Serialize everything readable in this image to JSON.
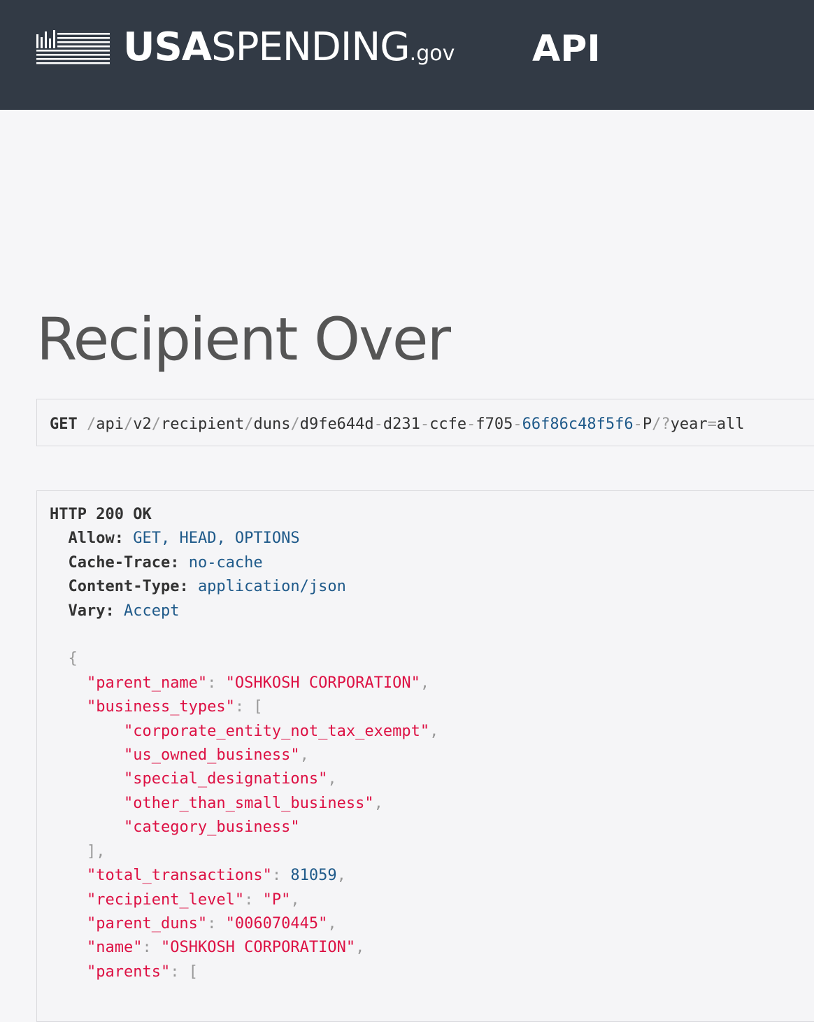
{
  "brand": {
    "usa": "USA",
    "spending": "SPENDING",
    "gov": ".gov",
    "api": "API",
    "logo_icon": "bar-lines-icon"
  },
  "page": {
    "title": "Recipient Over"
  },
  "request": {
    "method": "GET",
    "path_parts": [
      "/",
      "api",
      "/",
      "v2",
      "/",
      "recipient",
      "/",
      "duns",
      "/",
      "d9fe644d",
      "-",
      "d231",
      "-",
      "ccfe",
      "-",
      "f705",
      "-",
      "66f86c48f5f6",
      "-",
      "P",
      "/?",
      "year",
      "=",
      "all"
    ]
  },
  "response": {
    "status": "HTTP 200 OK",
    "headers": [
      {
        "name": "Allow:",
        "value": "GET, HEAD, OPTIONS"
      },
      {
        "name": "Cache-Trace:",
        "value": "no-cache"
      },
      {
        "name": "Content-Type:",
        "value": "application/json"
      },
      {
        "name": "Vary:",
        "value": "Accept"
      }
    ],
    "body": {
      "open_brace": "{",
      "parent_name_key": "\"parent_name\"",
      "parent_name_value": "\"OSHKOSH CORPORATION\"",
      "business_types_key": "\"business_types\"",
      "business_types": [
        "\"corporate_entity_not_tax_exempt\"",
        "\"us_owned_business\"",
        "\"special_designations\"",
        "\"other_than_small_business\"",
        "\"category_business\""
      ],
      "total_transactions_key": "\"total_transactions\"",
      "total_transactions_value": "81059",
      "recipient_level_key": "\"recipient_level\"",
      "recipient_level_value": "\"P\"",
      "parent_duns_key": "\"parent_duns\"",
      "parent_duns_value": "\"006070445\"",
      "name_key": "\"name\"",
      "name_value": "\"OSHKOSH CORPORATION\"",
      "parents_key": "\"parents\""
    }
  }
}
